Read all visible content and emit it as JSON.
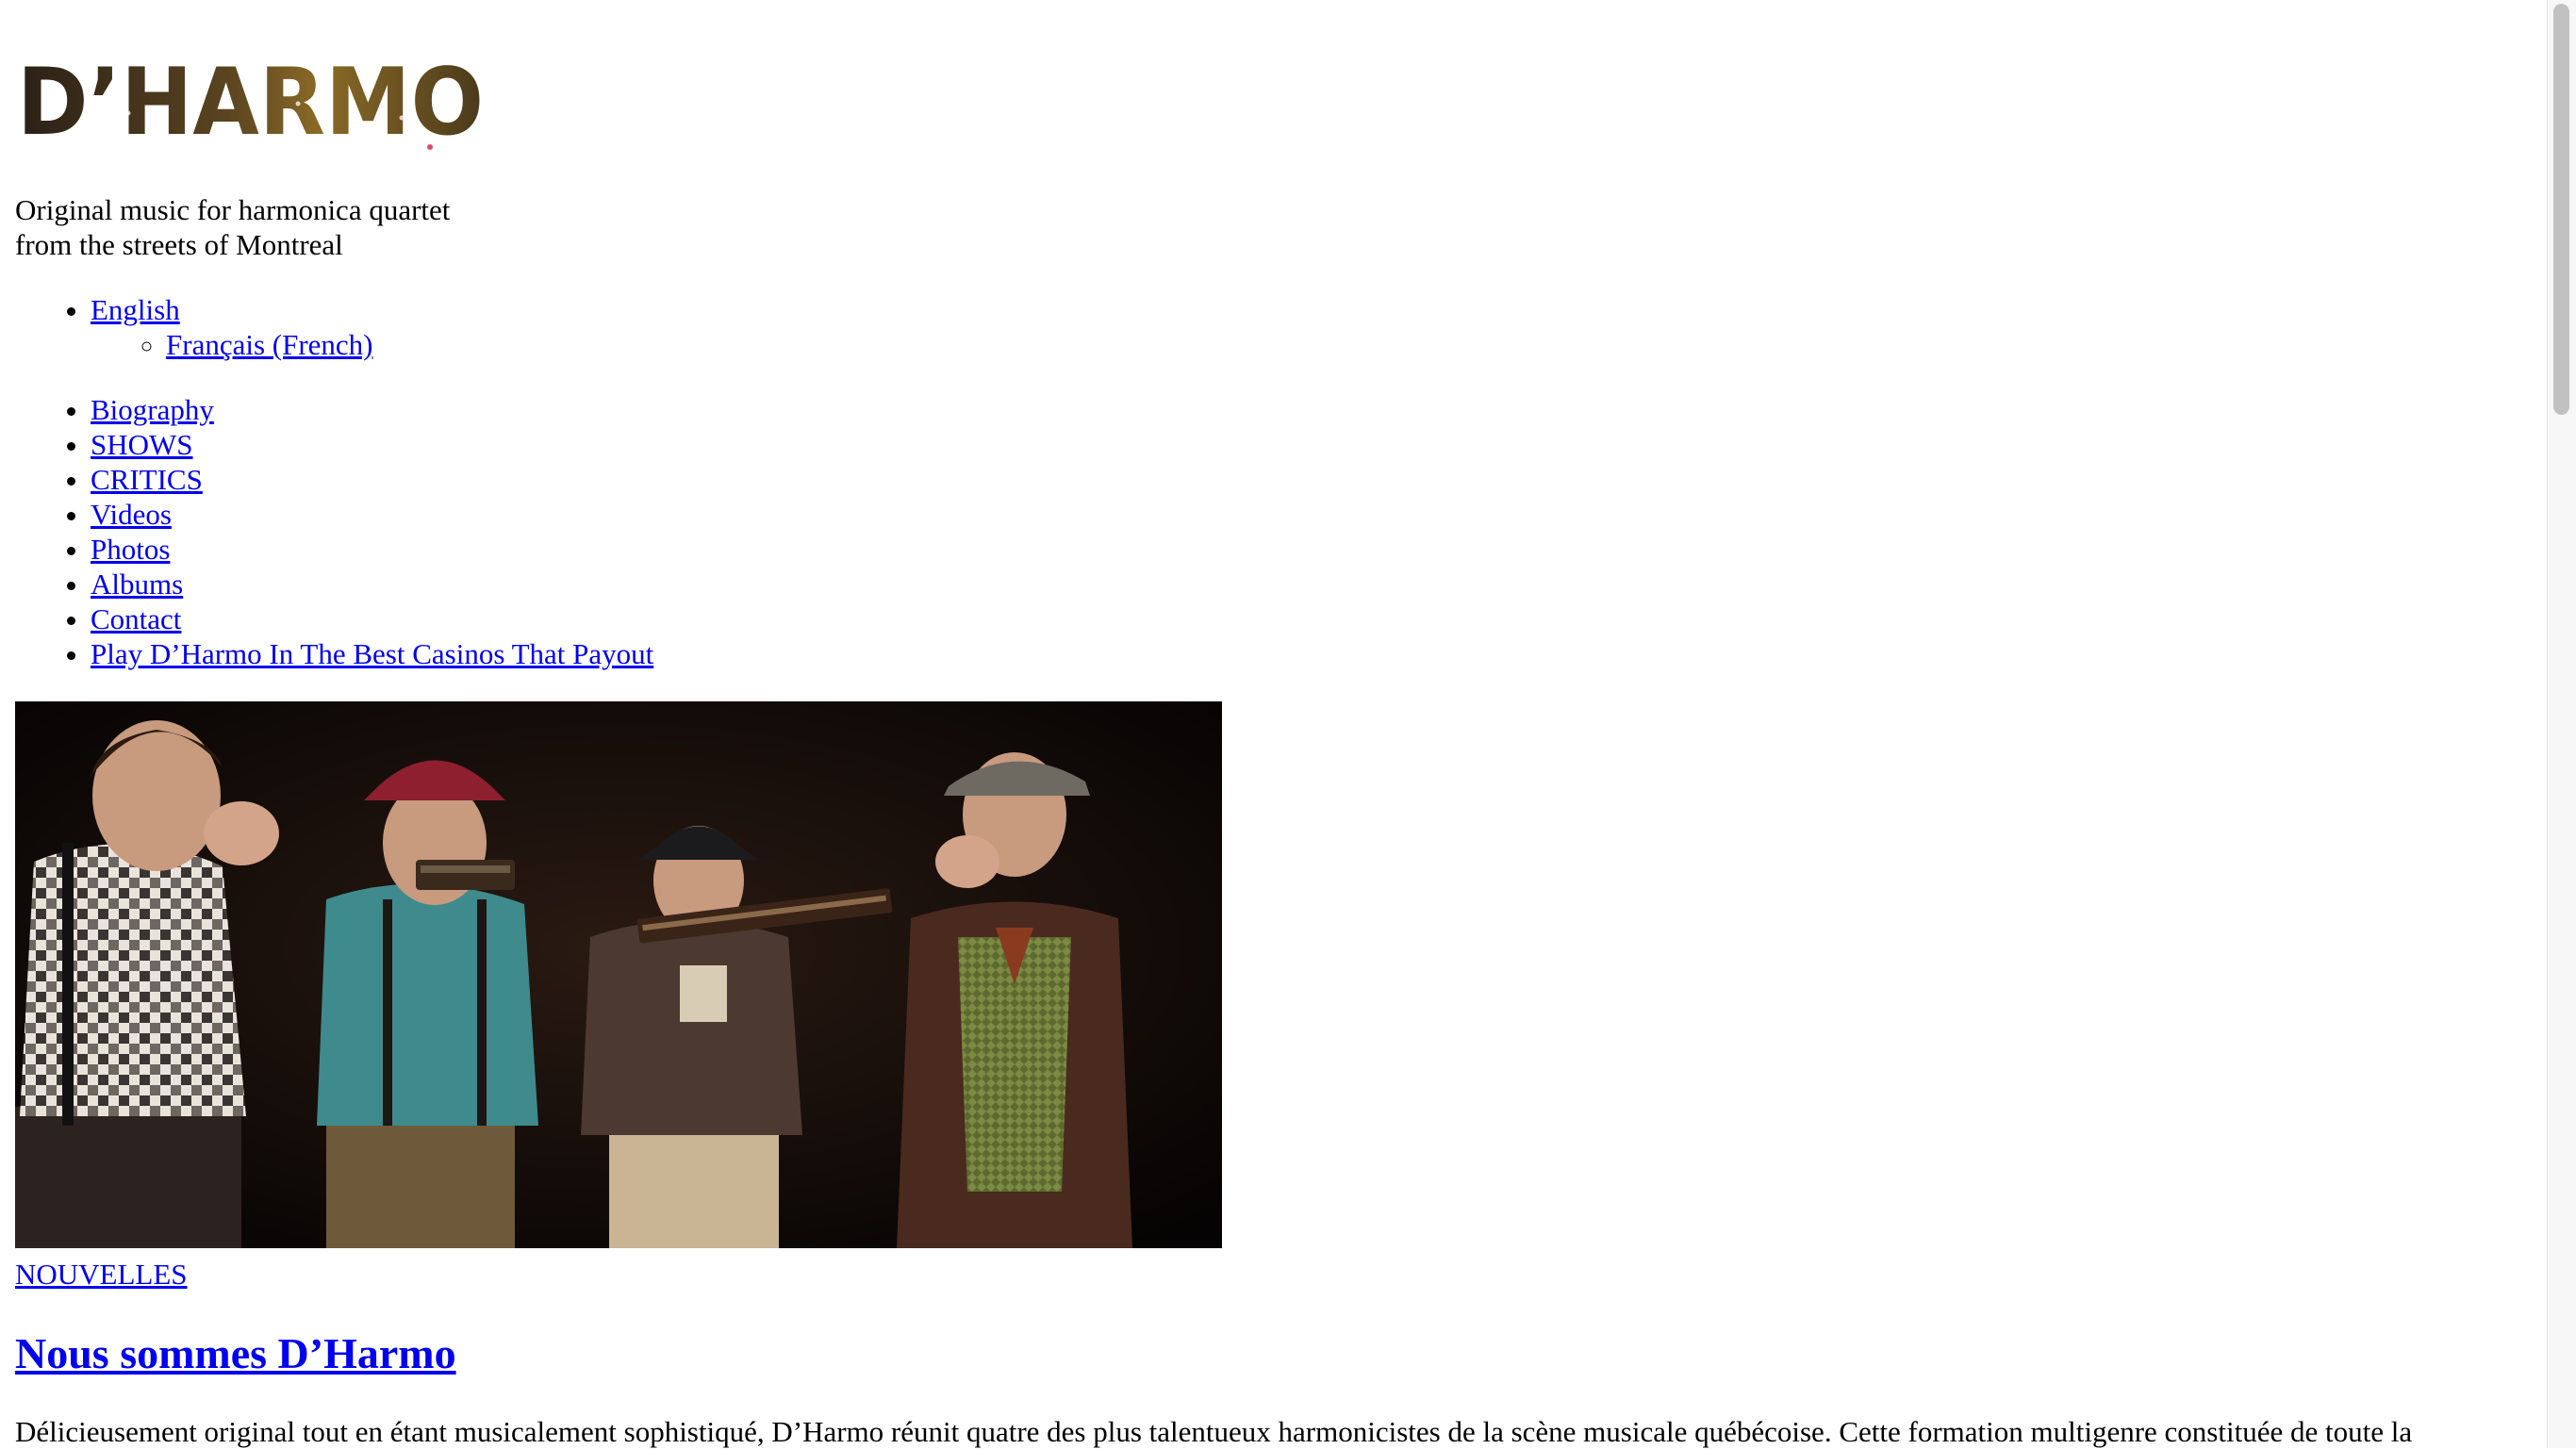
{
  "header": {
    "logo_text": "D’HARMO",
    "tagline_line1": "Original music for harmonica quartet",
    "tagline_line2": "from the streets of Montreal"
  },
  "languages": {
    "current": "English",
    "alternate": "Français (French)"
  },
  "nav": {
    "items": [
      {
        "label": "Biography"
      },
      {
        "label": "SHOWS"
      },
      {
        "label": "CRITICS"
      },
      {
        "label": "Videos"
      },
      {
        "label": "Photos"
      },
      {
        "label": "Albums"
      },
      {
        "label": "Contact"
      },
      {
        "label": "Play D’Harmo In The Best Casinos That Payout"
      }
    ]
  },
  "post": {
    "category": "NOUVELLES",
    "title": "Nous sommes D’Harmo",
    "excerpt": "Délicieusement original tout en étant musicalement sophistiqué, D’Harmo réunit quatre des plus talentueux harmonicistes de la scène musicale québécoise. Cette formation multigenre constituée de toute la"
  },
  "colors": {
    "link": "#0000ee",
    "logo_dark": "#2a2016",
    "logo_gold": "#8a6a26",
    "hero_bg": "#0a0706"
  }
}
